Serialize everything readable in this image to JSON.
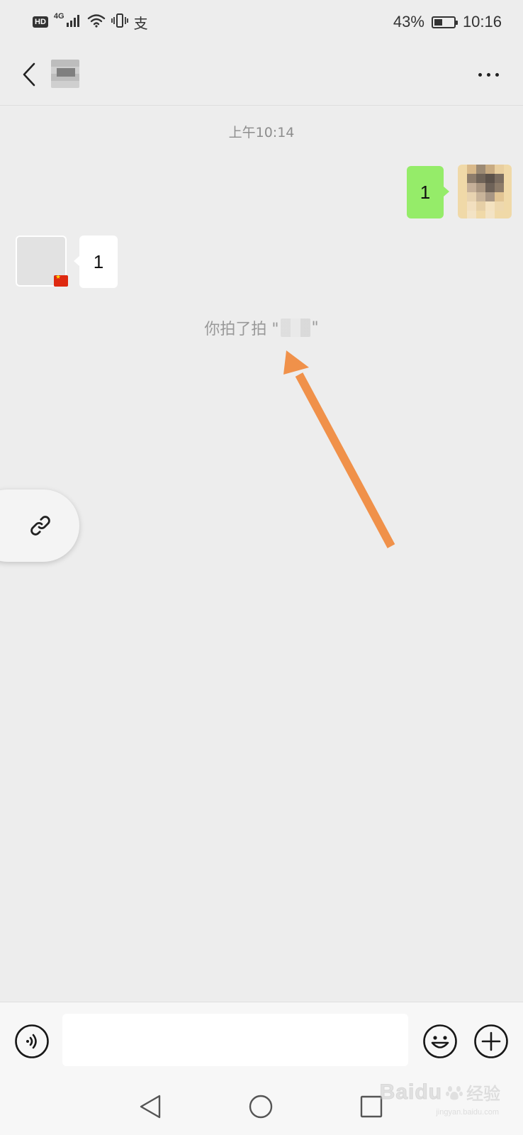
{
  "status_bar": {
    "hd_label": "HD",
    "network_label": "4G",
    "extra_icon_text": "支",
    "battery_percent_text": "43%",
    "battery_level": 0.43,
    "time": "10:16"
  },
  "header": {
    "contact_name_blurred": true
  },
  "chat": {
    "timestamp": "上午10:14",
    "sent_message": "1",
    "received_message": "1",
    "pat_notice_prefix": "你拍了拍 \"",
    "pat_notice_suffix": "\""
  },
  "annotation": {
    "arrow_color": "#f0914a"
  },
  "input_bar": {
    "message_value": "",
    "message_placeholder": ""
  },
  "watermark": {
    "brand": "Baidu",
    "cn": "经验",
    "url": "jingyan.baidu.com"
  },
  "colors": {
    "background": "#ededed",
    "sent_bubble": "#95ec69",
    "received_bubble": "#ffffff"
  }
}
